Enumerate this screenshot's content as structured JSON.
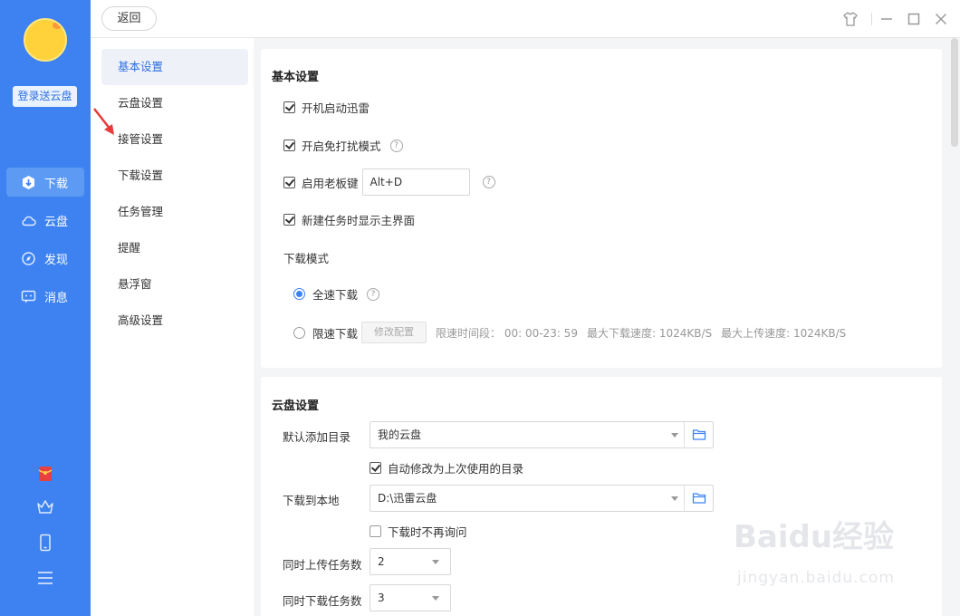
{
  "sidebar": {
    "login_label": "登录送云盘",
    "nav": [
      {
        "label": "下载",
        "icon": "download-icon",
        "active": true
      },
      {
        "label": "云盘",
        "icon": "cloud-icon",
        "active": false
      },
      {
        "label": "发现",
        "icon": "discover-icon",
        "active": false
      },
      {
        "label": "消息",
        "icon": "message-icon",
        "active": false
      }
    ],
    "bottom_icons": [
      "red-packet-icon",
      "crown-icon",
      "phone-icon",
      "menu-icon"
    ],
    "accent": "#3d82f0"
  },
  "topbar": {
    "back_label": "返回",
    "window_icons": [
      "skin-icon",
      "minimize-icon",
      "maximize-icon",
      "close-icon"
    ]
  },
  "settings_nav": {
    "items": [
      "基本设置",
      "云盘设置",
      "接管设置",
      "下载设置",
      "任务管理",
      "提醒",
      "悬浮窗",
      "高级设置"
    ],
    "active_index": 0
  },
  "basic": {
    "title": "基本设置",
    "startup_label": "开机启动迅雷",
    "dnd_label": "开启免打扰模式",
    "bosskey_label": "启用老板键",
    "bosskey_value": "Alt+D",
    "show_main_label": "新建任务时显示主界面",
    "download_mode_label": "下载模式",
    "full_speed_label": "全速下载",
    "limit_speed_label": "限速下载",
    "modify_config_label": "修改配置",
    "limit_period": "限速时间段： 00: 00-23: 59",
    "max_download": "最大下载速度: 1024KB/S",
    "max_upload": "最大上传速度: 1024KB/S",
    "help_glyph": "?"
  },
  "cloud": {
    "title": "云盘设置",
    "default_dir_label": "默认添加目录",
    "default_dir_value": "我的云盘",
    "auto_modify_label": "自动修改为上次使用的目录",
    "local_label": "下载到本地",
    "local_value": "D:\\迅雷云盘",
    "no_ask_label": "下载时不再询问",
    "upload_tasks_label": "同时上传任务数",
    "upload_tasks_value": "2",
    "download_tasks_label": "同时下载任务数",
    "download_tasks_value": "3"
  },
  "watermark": {
    "main": "Baidu经验",
    "sub": "jingyan.baidu.com"
  }
}
